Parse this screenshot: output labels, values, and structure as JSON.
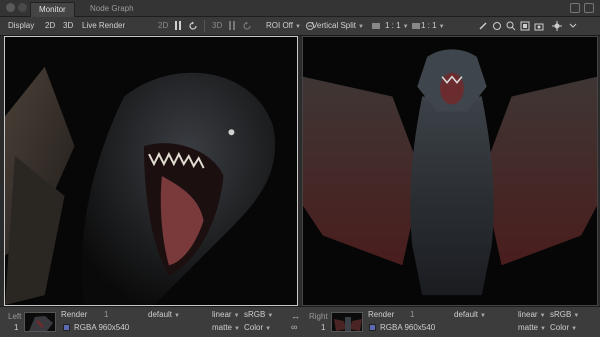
{
  "tabs": {
    "monitor": "Monitor",
    "node_graph": "Node Graph"
  },
  "toolbar": {
    "display": "Display",
    "two_d": "2D",
    "three_d": "3D",
    "live_render": "Live Render",
    "mode_2d": "2D",
    "mode_3d": "3D",
    "roi": "ROI Off",
    "split": "Vertical Split",
    "ratio_a": "1 : 1",
    "ratio_b": "1 : 1"
  },
  "bottom": {
    "left": {
      "side_label": "Left",
      "slot": "1",
      "name": "Render",
      "frame": "1",
      "view": "default",
      "format": "RGBA  960x540",
      "colorspace": "linear",
      "display_space": "sRGB",
      "matte": "matte",
      "channel": "Color"
    },
    "right": {
      "side_label": "Right",
      "slot": "1",
      "name": "Render",
      "frame": "1",
      "view": "default",
      "format": "RGBA  960x540",
      "colorspace": "linear",
      "display_space": "sRGB",
      "matte": "matte",
      "channel": "Color"
    }
  },
  "icons": {
    "menu": "menu-icon",
    "refresh": "refresh-icon",
    "pause": "pause-icon",
    "swap": "swap-arrows-icon"
  },
  "colors": {
    "accent": "#5a6bb0",
    "panel": "#3a3a3a",
    "viewer_bg": "#0a0a0a"
  }
}
